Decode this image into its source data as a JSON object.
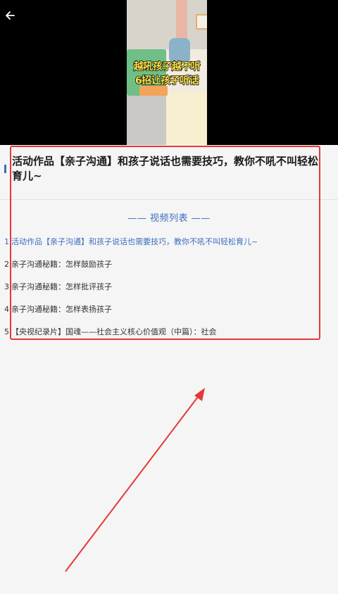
{
  "video": {
    "caption_line1": "越吼孩子越不听",
    "caption_line2": "6招让孩子听话"
  },
  "main": {
    "title": "活动作品【亲子沟通】和孩子说话也需要技巧，教你不吼不叫轻松育儿~",
    "list_heading": "—— 视频列表 ——",
    "items": [
      {
        "index": "1",
        "label": "活动作品【亲子沟通】和孩子说话也需要技巧，教你不吼不叫轻松育儿~"
      },
      {
        "index": "2",
        "label": "亲子沟通秘籍：怎样鼓励孩子"
      },
      {
        "index": "3",
        "label": "亲子沟通秘籍：怎样批评孩子"
      },
      {
        "index": "4",
        "label": "亲子沟通秘籍：怎样表扬孩子"
      },
      {
        "index": "5",
        "label": "【央视纪录片】国魂——社会主义核心价值观（中篇）：社会"
      }
    ]
  },
  "colors": {
    "accent": "#3a6fc0",
    "annotation": "#e53935",
    "video_bg": "#000000"
  }
}
